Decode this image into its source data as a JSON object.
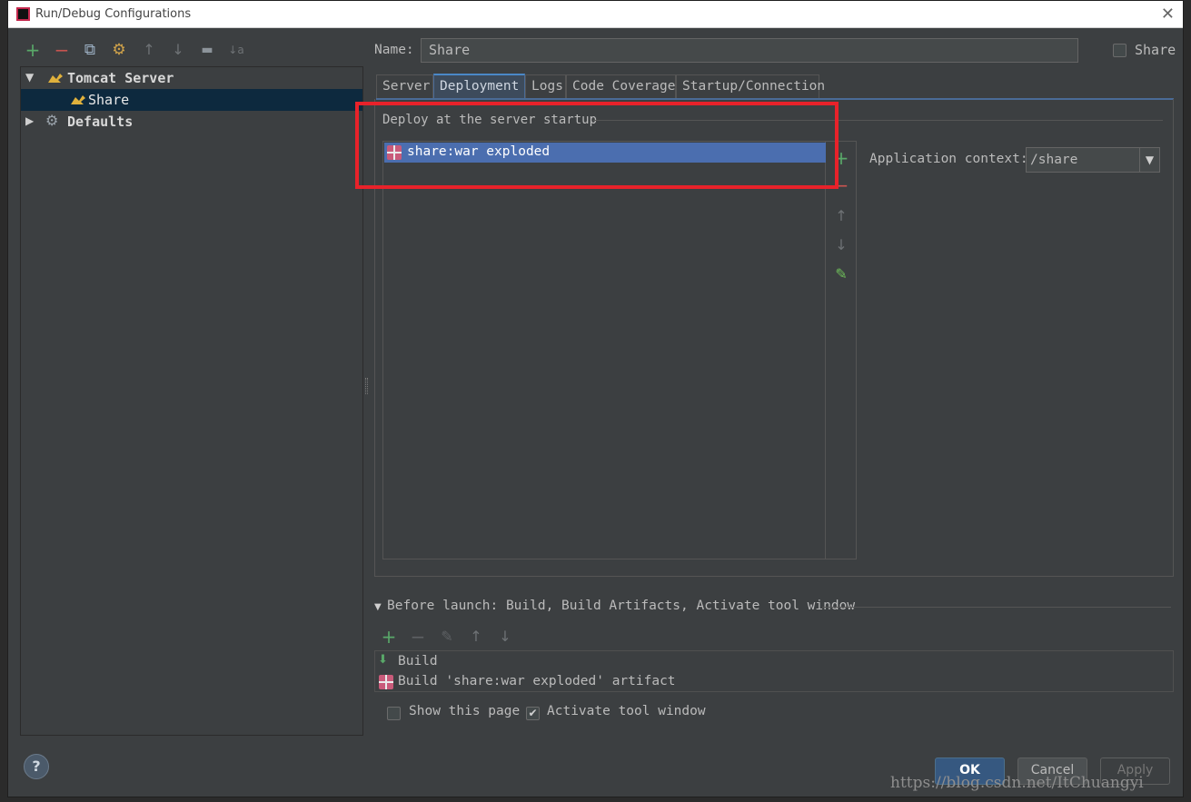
{
  "window": {
    "title": "Run/Debug Configurations"
  },
  "toolbar": {
    "add": "+",
    "remove": "−",
    "copy": "⧉",
    "edit": "⚙",
    "up": "↑",
    "down": "↓",
    "folder": "▬",
    "sort": "↓a"
  },
  "tree": {
    "tomcat_label": "Tomcat Server",
    "share_label": "Share",
    "defaults_label": "Defaults"
  },
  "name": {
    "label": "Name:",
    "value": "Share"
  },
  "share_checkbox": {
    "label": "Share",
    "checked": false
  },
  "tabs": [
    {
      "label": "Server"
    },
    {
      "label": "Deployment",
      "active": true
    },
    {
      "label": "Logs"
    },
    {
      "label": "Code Coverage"
    },
    {
      "label": "Startup/Connection"
    }
  ],
  "deployment": {
    "section_title": "Deploy at the server startup",
    "items": [
      "share:war exploded"
    ],
    "context_label": "Application context:",
    "context_value": "/share"
  },
  "before_launch": {
    "title": "Before launch: Build, Build Artifacts, Activate tool window",
    "items": [
      "Build",
      "Build 'share:war exploded' artifact"
    ]
  },
  "options": {
    "show_page": {
      "label": "Show this page",
      "checked": false
    },
    "activate_tool": {
      "label": "Activate tool window",
      "checked": true
    }
  },
  "buttons": {
    "ok": "OK",
    "cancel": "Cancel",
    "apply": "Apply",
    "help": "?"
  },
  "watermark": "https://blog.csdn.net/ItChuangyi",
  "colors": {
    "accent": "#4b6eaf",
    "highlight": "#e8222a",
    "green": "#59a869"
  }
}
